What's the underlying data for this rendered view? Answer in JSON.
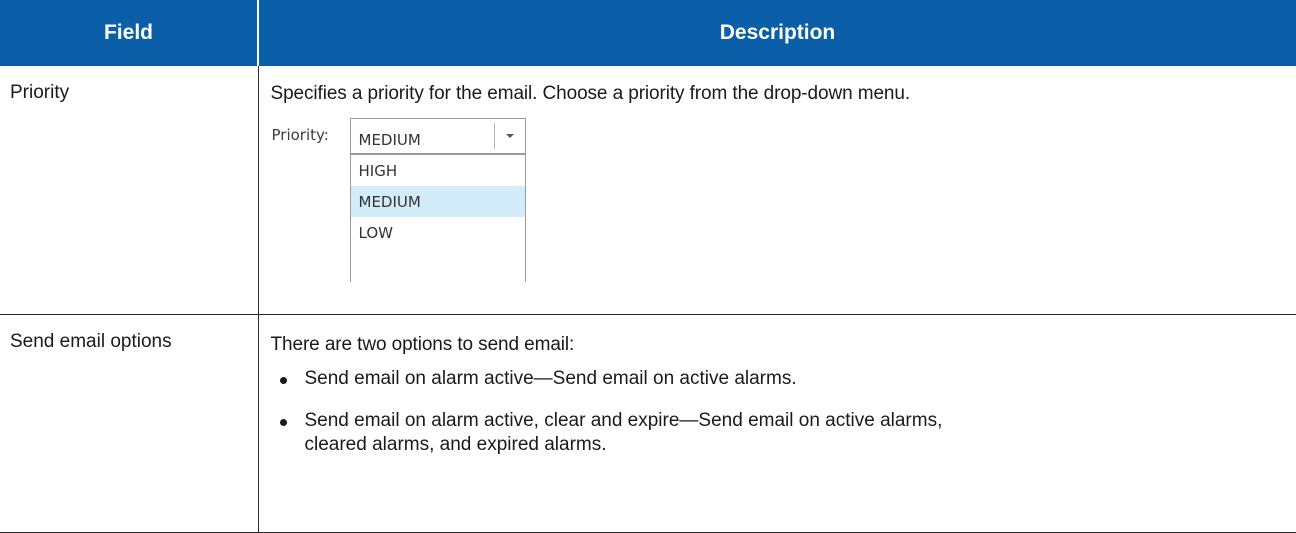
{
  "table": {
    "headers": {
      "field": "Field",
      "description": "Description"
    },
    "rows": [
      {
        "field": "Priority",
        "description": "Specifies a priority for the email. Choose a priority from the drop-down menu.",
        "dropdown": {
          "label": "Priority:",
          "selected": "MEDIUM",
          "options": [
            "HIGH",
            "MEDIUM",
            "LOW"
          ],
          "highlighted": "MEDIUM",
          "arrow_icon": "chevron-down-icon"
        }
      },
      {
        "field": "Send email options",
        "description": "There are two options to send email:",
        "options": [
          "Send email on alarm active—Send email on active alarms.",
          "Send email on alarm active, clear and expire—Send email on active alarms, cleared alarms, and expired alarms."
        ]
      }
    ]
  },
  "colors": {
    "header_background": "#0b5fa8",
    "header_text": "#ffffff",
    "highlight": "#d2ecfa"
  }
}
